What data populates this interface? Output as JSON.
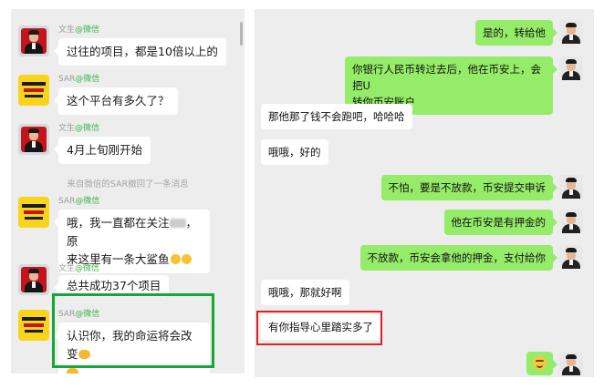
{
  "left_chat": {
    "messages": [
      {
        "sender": "文生",
        "source": "@微信",
        "avatar": "man-avatar",
        "text": "过往的项目，都是10倍以上的"
      },
      {
        "sender": "SAR",
        "source": "@微信",
        "avatar": "sar-avatar",
        "text": "这个平台有多久了？"
      },
      {
        "sender": "文生",
        "source": "@微信",
        "avatar": "man-avatar",
        "text": "4月上旬刚开始"
      },
      {
        "sender": "SAR",
        "source": "@微信",
        "avatar": "sar-avatar",
        "text_line1": "哦，我一直都在关注",
        "text_line1_end": "，原",
        "text_line2": "来这里有一条大鲨鱼"
      },
      {
        "sender": "文生",
        "source": "@微信",
        "avatar": "man-avatar",
        "text": "总共成功37个项目"
      },
      {
        "sender": "SAR",
        "source": "@微信",
        "avatar": "sar-avatar",
        "text": "认识你，我的命运将会改变"
      }
    ],
    "system_notice": "来自微信的SAR撤回了一条消息"
  },
  "right_chat": {
    "messages": [
      {
        "side": "self",
        "text": "是的，转给他"
      },
      {
        "side": "self",
        "text_line1": "你银行人民币转过去后，他在币安上，会把U",
        "text_line2": "转你币安账户"
      },
      {
        "side": "other",
        "text": "那他那了钱不会跑吧，哈哈哈"
      },
      {
        "side": "other",
        "text": "哦哦，好的"
      },
      {
        "side": "self",
        "text": "不怕，要是不放款，币安提交申诉"
      },
      {
        "side": "self",
        "text": "他在币安是有押金的"
      },
      {
        "side": "self",
        "text": "不放款，币安会拿他的押金，支付给你"
      },
      {
        "side": "other",
        "text": "哦哦，那就好啊"
      },
      {
        "side": "other",
        "text": "有你指导心里踏实多了"
      },
      {
        "side": "self",
        "emoji": "smile-emoji"
      }
    ]
  },
  "colors": {
    "wechat_green_bubble": "#95ec69",
    "chat_background": "#ededed",
    "highlight_green": "#11a838",
    "highlight_red": "#e02020",
    "wechat_source_green": "#3fb34f"
  }
}
